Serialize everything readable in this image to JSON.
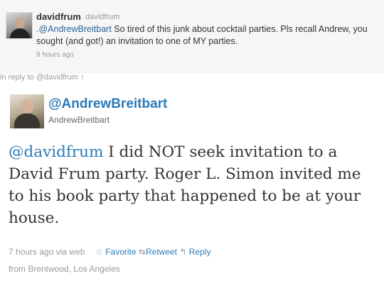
{
  "parent_tweet": {
    "name": "davidfrum",
    "handle": "davidfrum",
    "mention": ".@AndrewBreitbart",
    "text_after_mention": " So tired of this junk about cocktail parties. Pls recall Andrew, you sought (and got!) an invitation to one of MY parties.",
    "timestamp": "9 hours ago"
  },
  "reply_context": {
    "text": "in reply to @davidfrum",
    "arrow": "↑"
  },
  "main_tweet": {
    "name": "@AndrewBreitbart",
    "username": "AndrewBreitbart",
    "mention": "@davidfrum",
    "text_after_mention": " I did NOT seek invitation to a David Frum party. Roger L. Simon invited me to his book party that happened to be at your house.",
    "timestamp": "7 hours ago",
    "via": "via web",
    "favorite_label": "Favorite",
    "retweet_label": "Retweet",
    "reply_label": "Reply",
    "location": "from Brentwood, Los Angeles"
  },
  "icons": {
    "favorite": "star-icon",
    "retweet": "retweet-icon",
    "reply": "reply-icon"
  }
}
